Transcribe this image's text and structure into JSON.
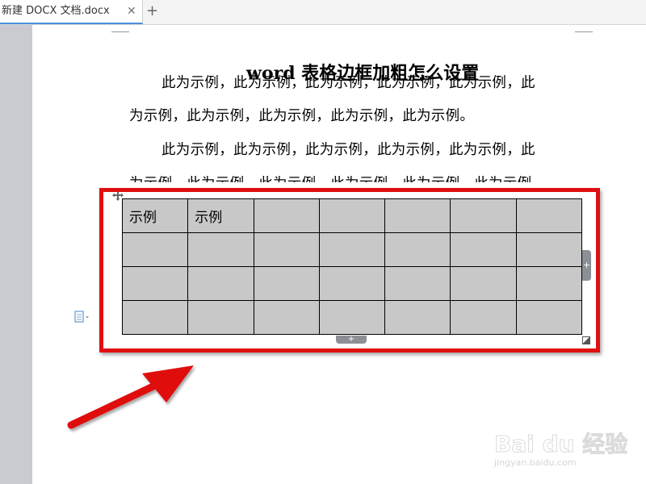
{
  "tab": {
    "title": "新建 DOCX 文档.docx",
    "close_glyph": "✕",
    "new_glyph": "+"
  },
  "document": {
    "title": "word 表格边框加粗怎么设置",
    "paragraph1": {
      "line1": "此为示例，此为示例，此为示例，此为示例，此为示例，此",
      "line2": "为示例，此为示例，此为示例，此为示例，此为示例。"
    },
    "paragraph2": {
      "line1": "此为示例，此为示例，此为示例，此为示例，此为示例，此",
      "line2": "为示例，此为示例，此为示例，此为示例，此为示例，此为示例。"
    }
  },
  "table": {
    "rows": [
      [
        "示例",
        "示例",
        "",
        "",
        "",
        "",
        ""
      ],
      [
        "",
        "",
        "",
        "",
        "",
        "",
        ""
      ],
      [
        "",
        "",
        "",
        "",
        "",
        "",
        ""
      ],
      [
        "",
        "",
        "",
        "",
        "",
        "",
        ""
      ]
    ],
    "cell_background": "#c8c8c8",
    "add_glyph": "+"
  },
  "annotation": {
    "color": "#e01010"
  },
  "watermark": {
    "brand": "Bai du 经验",
    "url": "jingyan.baidu.com"
  },
  "icons": {
    "move": "table-move-icon",
    "para": "paragraph-mark-icon"
  }
}
